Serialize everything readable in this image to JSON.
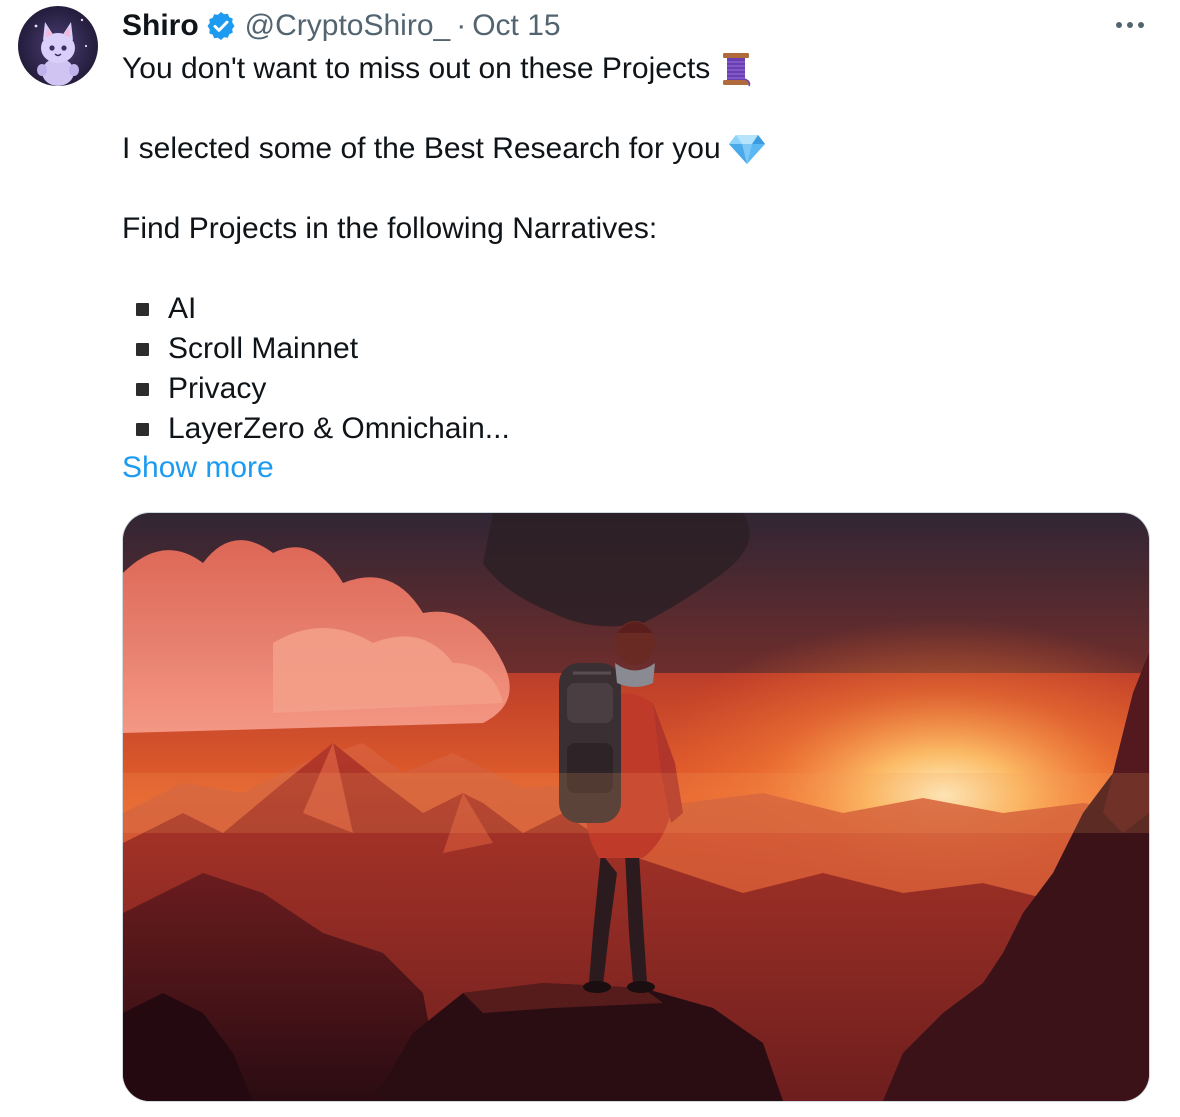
{
  "tweet": {
    "author": {
      "name": "Shiro",
      "handle": "@CryptoShiro_",
      "separator": "·",
      "date": "Oct 15"
    },
    "lines": {
      "l1": "You don't want to miss out on these Projects",
      "l2": "I selected some of the Best Research for you",
      "l3": "Find Projects in the following Narratives:"
    },
    "bullets": [
      "AI",
      "Scroll Mainnet",
      "Privacy",
      "LayerZero & Omnichain..."
    ],
    "show_more": "Show more",
    "icons": {
      "verified": "verified-badge-icon",
      "more": "more-options-icon",
      "thread": "thread-spool-icon",
      "gem": "gem-stone-icon"
    },
    "colors": {
      "link": "#1d9bf0",
      "verified": "#1d9bf0",
      "secondary_text": "#536471",
      "primary_text": "#0f1419"
    }
  }
}
